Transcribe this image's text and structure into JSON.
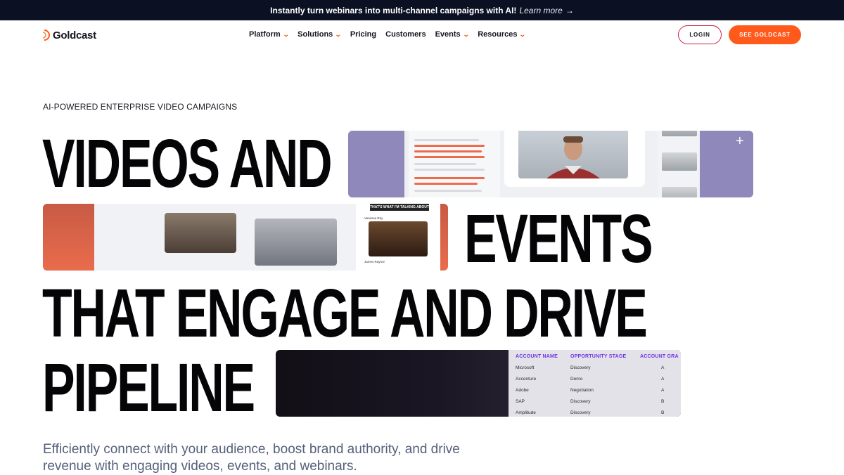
{
  "announcement": {
    "text": "Instantly turn webinars into multi-channel campaigns with AI!",
    "link": "Learn more",
    "arrow": "→"
  },
  "brand": {
    "name": "Goldcast",
    "accent": "#ff5a1c",
    "dark": "#0b1023"
  },
  "nav": {
    "items": [
      {
        "label": "Platform",
        "dropdown": true
      },
      {
        "label": "Solutions",
        "dropdown": true
      },
      {
        "label": "Pricing",
        "dropdown": false
      },
      {
        "label": "Customers",
        "dropdown": false
      },
      {
        "label": "Events",
        "dropdown": true
      },
      {
        "label": "Resources",
        "dropdown": true
      }
    ],
    "login": "LOGIN",
    "cta": "SEE GOLDCAST"
  },
  "hero": {
    "eyebrow": "AI-POWERED ENTERPRISE VIDEO CAMPAIGNS",
    "line1": "VIDEOS AND",
    "line2": "EVENTS",
    "line3": "THAT ENGAGE AND DRIVE",
    "line4": "PIPELINE",
    "subtitle": "Efficiently connect with your audience, boost brand authority, and drive revenue with engaging videos, events, and webinars."
  },
  "card2": {
    "banner": "THAT'S WHAT I'M TALKING ABOUT",
    "chat1": "Vanessa Ray",
    "chat2": "James Raynor"
  },
  "table": {
    "headers": [
      "ACCOUNT NAME",
      "OPPORTUNITY STAGE",
      "ACCOUNT GRA"
    ],
    "rows": [
      [
        "Microsoft",
        "Discovery",
        "A"
      ],
      [
        "Accenture",
        "Demo",
        "A"
      ],
      [
        "Adobe",
        "Negotiation",
        "A"
      ],
      [
        "SAP",
        "Discovery",
        "B"
      ],
      [
        "Amplitude",
        "Discovery",
        "B"
      ]
    ]
  }
}
